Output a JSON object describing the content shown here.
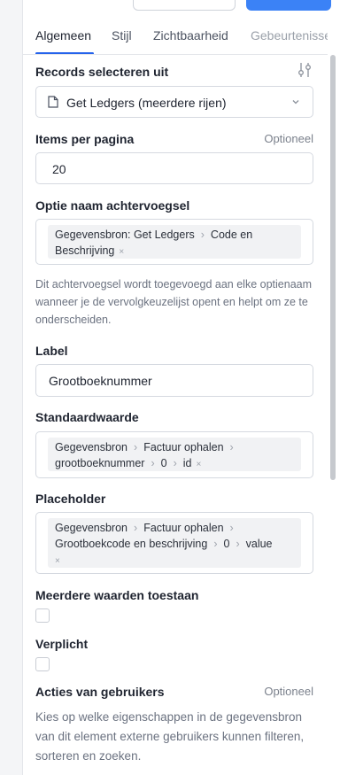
{
  "tabs": [
    {
      "label": "Algemeen",
      "active": true
    },
    {
      "label": "Stijl"
    },
    {
      "label": "Zichtbaarheid"
    },
    {
      "label": "Gebeurtenissen"
    }
  ],
  "records": {
    "label": "Records selecteren uit",
    "value": "Get Ledgers (meerdere rijen)",
    "settings_icon": "sliders-icon",
    "doc_icon": "document-icon",
    "chevron_icon": "chevron-down-icon"
  },
  "items_per_page": {
    "label": "Items per pagina",
    "optional": "Optioneel",
    "value": "20"
  },
  "suffix": {
    "label": "Optie naam achtervoegsel",
    "chip_line1_a": "Gegevensbron: Get Ledgers",
    "chip_line1_b": "Code en",
    "chip_line2": "Beschrijving",
    "help": "Dit achtervoegsel wordt toegevoegd aan elke optienaam wanneer je de vervolgkeuzelijst opent en helpt om ze te onderscheiden."
  },
  "label_field": {
    "label": "Label",
    "value": "Grootboeknummer"
  },
  "default_value": {
    "label": "Standaardwaarde",
    "parts_line1": [
      "Gegevensbron",
      "Factuur ophalen"
    ],
    "parts_line2": [
      "grootboeknummer",
      "0",
      "id"
    ]
  },
  "placeholder": {
    "label": "Placeholder",
    "parts_line1": [
      "Gegevensbron",
      "Factuur ophalen"
    ],
    "parts_line2": [
      "Grootboekcode en beschrijving",
      "0",
      "value"
    ]
  },
  "multiple": {
    "label": "Meerdere waarden toestaan"
  },
  "required": {
    "label": "Verplicht"
  },
  "user_actions": {
    "label": "Acties van gebruikers",
    "optional": "Optioneel",
    "help": "Kies op welke eigenschappen in de gegevensbron van dit element externe gebruikers kunnen filteren, sorteren en zoeken."
  },
  "colors": {
    "accent": "#2563eb",
    "primary_button": "#3b82f6"
  }
}
